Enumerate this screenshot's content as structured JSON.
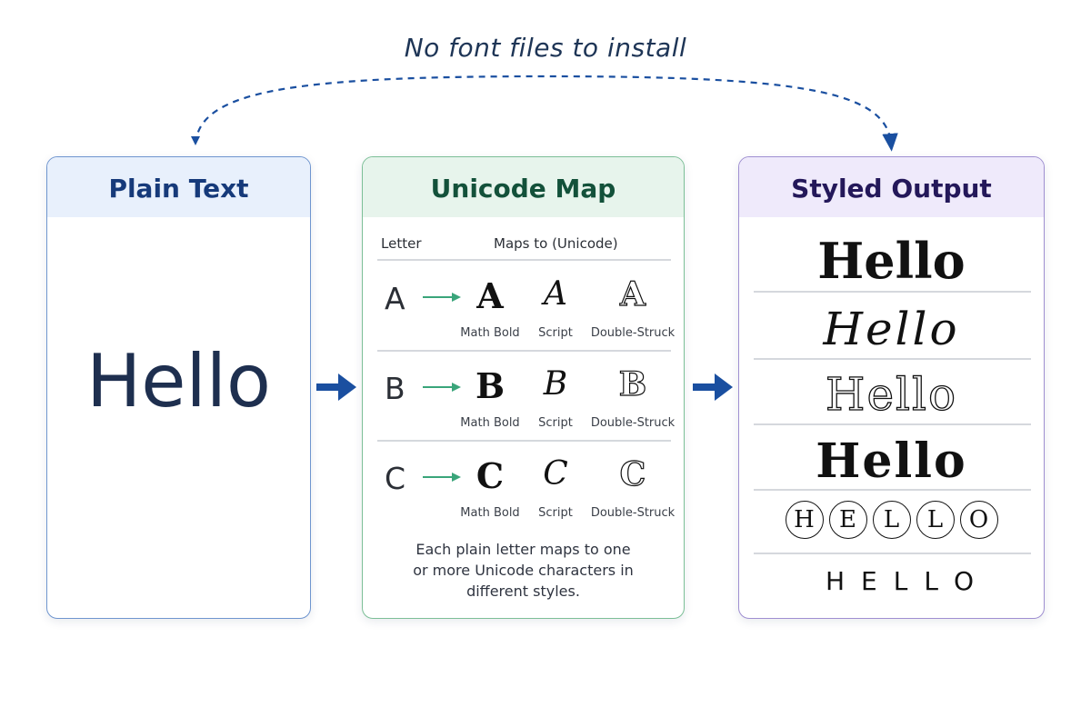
{
  "caption": "No font files to install",
  "colors": {
    "flow_arrow": "#1a4fa0",
    "map_arrow": "#3aa57a",
    "plain_border": "#6f95cf",
    "map_border": "#7cbf97",
    "output_border": "#9f8fd1"
  },
  "plain_panel": {
    "title": "Plain Text",
    "sample": "Hello"
  },
  "map_panel": {
    "title": "Unicode Map",
    "col_letter": "Letter",
    "col_maps": "Maps to (Unicode)",
    "rows": [
      {
        "letter": "A",
        "glyphs": [
          "A",
          "A",
          "A"
        ],
        "labels": [
          "Math Bold",
          "Script",
          "Double-Struck"
        ]
      },
      {
        "letter": "B",
        "glyphs": [
          "B",
          "B",
          "B"
        ],
        "labels": [
          "Math Bold",
          "Script",
          "Double-Struck"
        ]
      },
      {
        "letter": "C",
        "glyphs": [
          "C",
          "C",
          "C"
        ],
        "labels": [
          "Math Bold",
          "Script",
          "Double-Struck"
        ]
      }
    ],
    "note_lines": [
      "Each plain letter maps to one",
      "or more Unicode characters in",
      "different styles."
    ]
  },
  "output_panel": {
    "title": "Styled Output",
    "bold": "Hello",
    "script": "Hello",
    "double_struck": "Hello",
    "fraktur": "Hello",
    "circled": [
      "H",
      "E",
      "L",
      "L",
      "O"
    ],
    "spaced": "HELLO"
  }
}
